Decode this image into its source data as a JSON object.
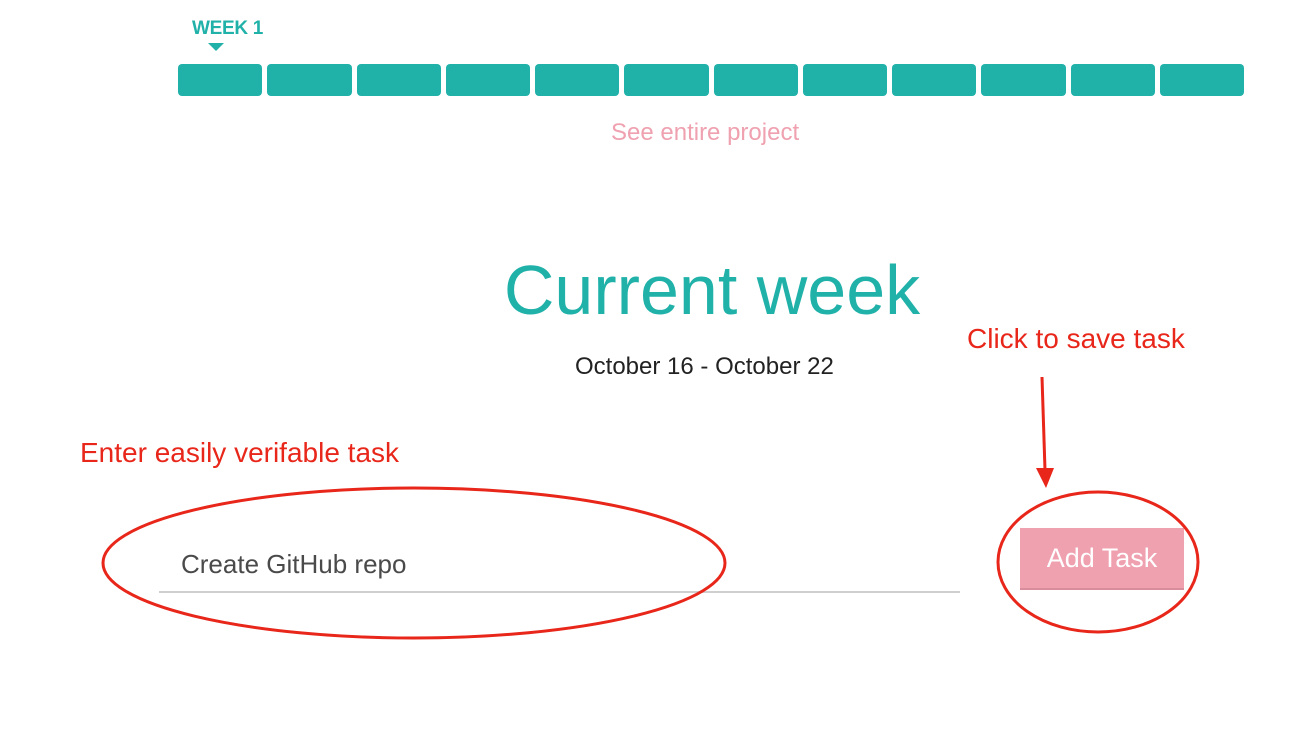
{
  "timeline": {
    "current_week_label": "WEEK 1",
    "week_count": 12,
    "see_project_link": "See entire project"
  },
  "current_week": {
    "title": "Current week",
    "date_range": "October 16 - October 22"
  },
  "task_form": {
    "input_value": "Create GitHub repo",
    "add_button_label": "Add Task"
  },
  "annotations": {
    "input_hint": "Enter easily verifable task",
    "button_hint": "Click to save task"
  },
  "colors": {
    "accent": "#20b1a9",
    "secondary": "#efa1b0",
    "annotation": "#e8261a"
  }
}
